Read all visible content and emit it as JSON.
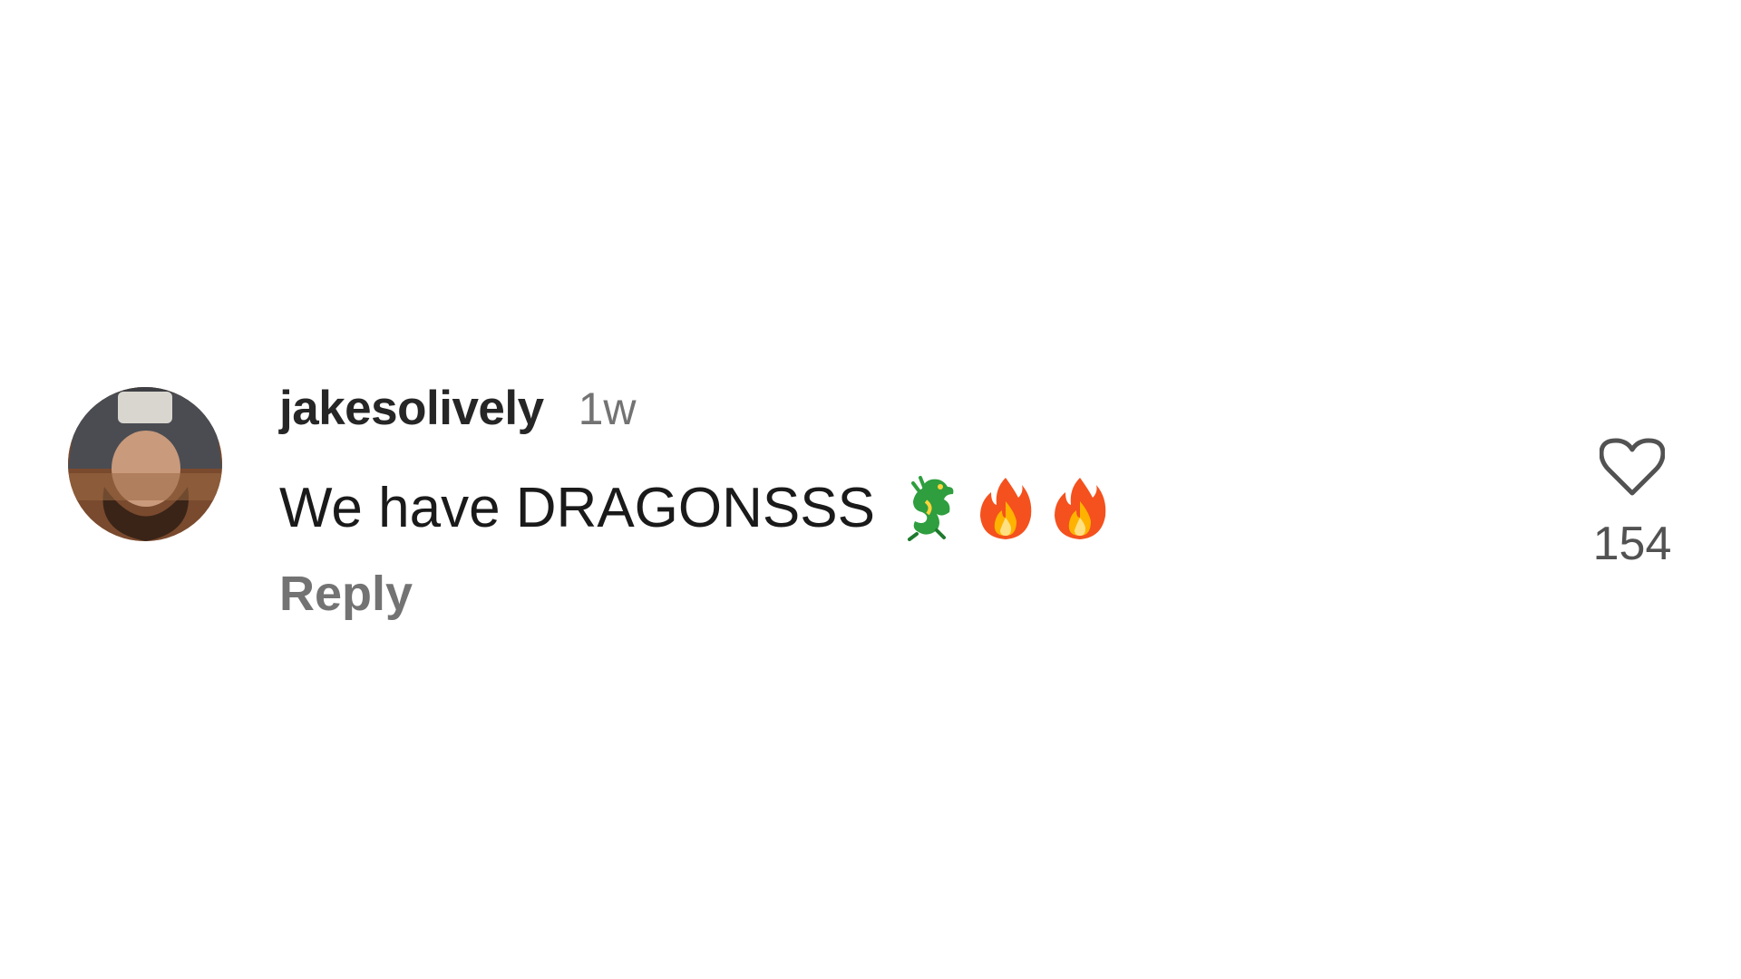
{
  "comment": {
    "username": "jakesolively",
    "timestamp": "1w",
    "text": "We have DRAGONSSS",
    "emojis": [
      "dragon-emoji",
      "fire-emoji",
      "fire-emoji"
    ],
    "reply_label": "Reply",
    "like_count": "154",
    "avatar_icon": "profile-photo"
  },
  "colors": {
    "username": "#262626",
    "meta": "#737373",
    "text": "#1a1a1a",
    "like_count": "#525252"
  }
}
